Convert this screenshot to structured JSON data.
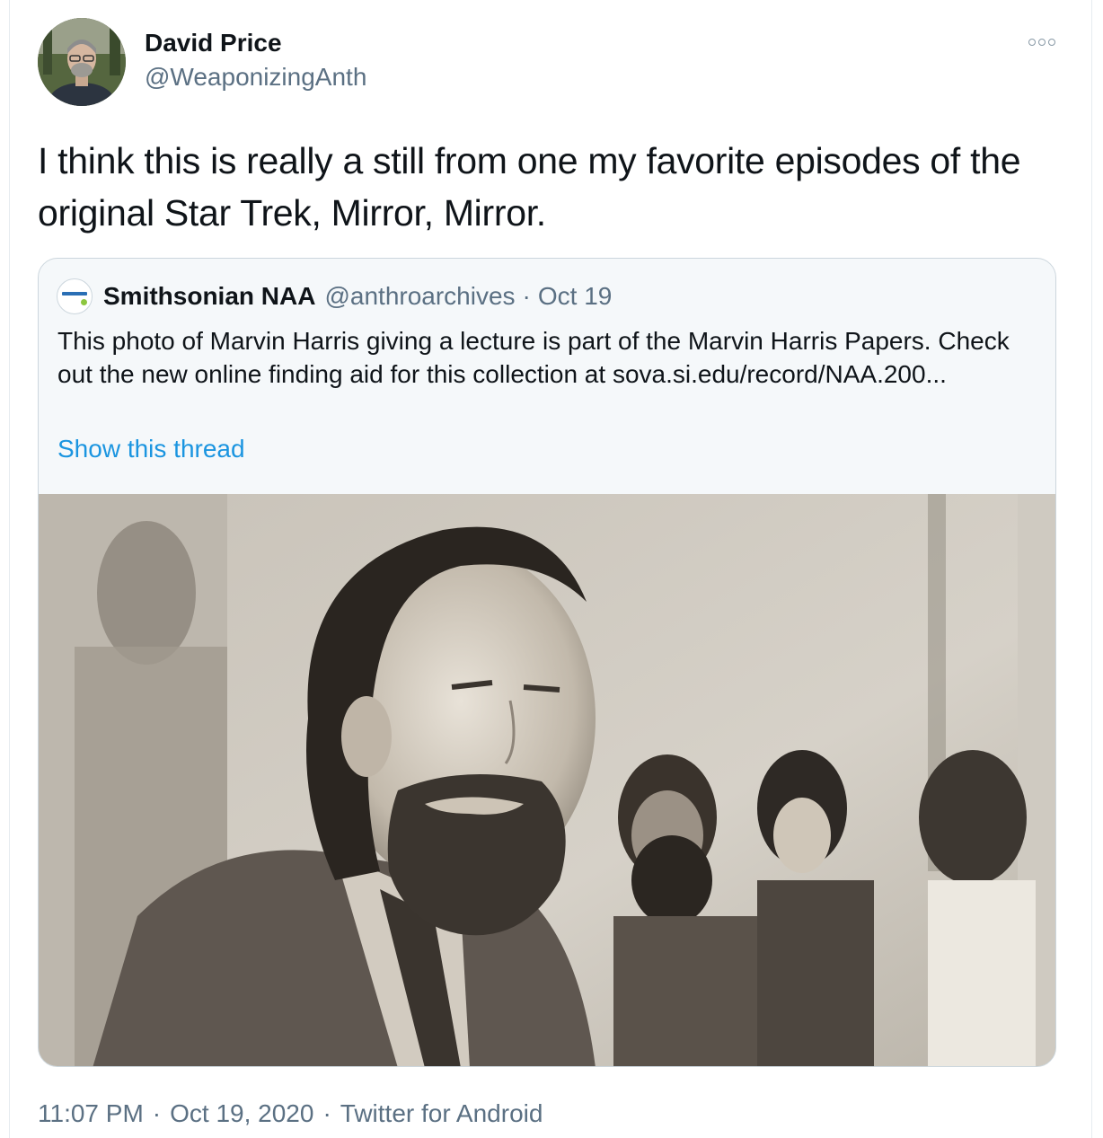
{
  "tweet": {
    "author_name": "David Price",
    "author_handle": "@WeaponizingAnth",
    "text": "I think this is really a still from one my favorite episodes of the original Star Trek, Mirror, Mirror.",
    "more_icon": "more-options-icon"
  },
  "quote": {
    "author_name": "Smithsonian NAA",
    "author_handle": "@anthroarchives",
    "separator": "·",
    "date": "Oct 19",
    "text": "This photo of Marvin Harris giving a lecture is part of the Marvin Harris Papers. Check out the new online finding aid for this collection at sova.si.edu/record/NAA.200...",
    "show_thread": "Show this thread",
    "photo_icon": "black-and-white-photo"
  },
  "footer": {
    "time": "11:07 PM",
    "separator": "·",
    "date": "Oct 19, 2020",
    "source": "Twitter for Android"
  },
  "colors": {
    "text": "#0f1419",
    "secondary": "#5b7083",
    "link": "#1b95e0",
    "border": "#ccd6dd",
    "card_bg": "#f5f8fa"
  }
}
